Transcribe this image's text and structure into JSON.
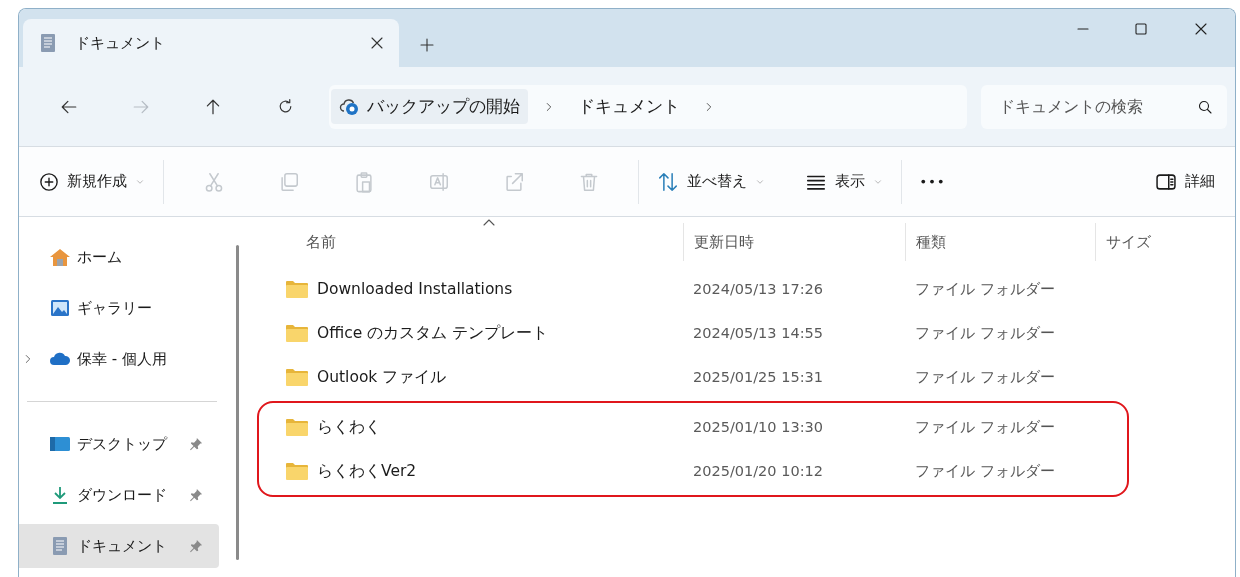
{
  "window": {
    "tab": {
      "title": "ドキュメント"
    }
  },
  "nav": [
    {
      "kind": "back",
      "disabled": false
    },
    {
      "kind": "forward",
      "disabled": true
    },
    {
      "kind": "up",
      "disabled": false
    },
    {
      "kind": "refresh",
      "disabled": false
    }
  ],
  "address_bar": {
    "breadcrumbs": [
      {
        "label": "バックアップの開始",
        "kind": "backup"
      },
      {
        "label": "ドキュメント",
        "kind": "plain"
      }
    ]
  },
  "search": {
    "placeholder": "ドキュメントの検索"
  },
  "toolbar": {
    "new": {
      "label": "新規作成"
    },
    "actions": [
      {
        "kind": "cut",
        "disabled": true
      },
      {
        "kind": "copy",
        "disabled": true
      },
      {
        "kind": "paste",
        "disabled": true
      },
      {
        "kind": "rename",
        "disabled": true
      },
      {
        "kind": "share",
        "disabled": true
      },
      {
        "kind": "delete",
        "disabled": true
      }
    ],
    "sort": {
      "label": "並べ替え"
    },
    "view": {
      "label": "表示"
    },
    "details": {
      "label": "詳細"
    }
  },
  "sidebar": {
    "groups": [
      {
        "items": [
          {
            "label": "ホーム",
            "kind": "home",
            "selected": false,
            "expandable": false,
            "pinned": false
          },
          {
            "label": "ギャラリー",
            "kind": "gallery",
            "selected": false,
            "expandable": false,
            "pinned": false
          },
          {
            "label": "保幸 - 個人用",
            "kind": "cloud",
            "selected": false,
            "expandable": true,
            "pinned": false
          }
        ]
      },
      {
        "items": [
          {
            "label": "デスクトップ",
            "kind": "desktop",
            "selected": false,
            "expandable": false,
            "pinned": true
          },
          {
            "label": "ダウンロード",
            "kind": "download",
            "selected": false,
            "expandable": false,
            "pinned": true
          },
          {
            "label": "ドキュメント",
            "kind": "documents",
            "selected": true,
            "expandable": false,
            "pinned": true
          }
        ]
      }
    ]
  },
  "file_list": {
    "columns": [
      {
        "label": "名前",
        "sorted": true
      },
      {
        "label": "更新日時",
        "sorted": false
      },
      {
        "label": "種類",
        "sorted": false
      },
      {
        "label": "サイズ",
        "sorted": false
      }
    ],
    "rows": [
      {
        "name": "Downloaded Installations",
        "modified": "2024/05/13 17:26",
        "type": "ファイル フォルダー",
        "highlighted": false
      },
      {
        "name": "Office のカスタム テンプレート",
        "modified": "2024/05/13 14:55",
        "type": "ファイル フォルダー",
        "highlighted": false
      },
      {
        "name": "Outlook ファイル",
        "modified": "2025/01/25 15:31",
        "type": "ファイル フォルダー",
        "highlighted": false
      },
      {
        "name": "らくわく",
        "modified": "2025/01/10 13:30",
        "type": "ファイル フォルダー",
        "highlighted": true
      },
      {
        "name": "らくわくVer2",
        "modified": "2025/01/20 10:12",
        "type": "ファイル フォルダー",
        "highlighted": true
      }
    ]
  }
}
